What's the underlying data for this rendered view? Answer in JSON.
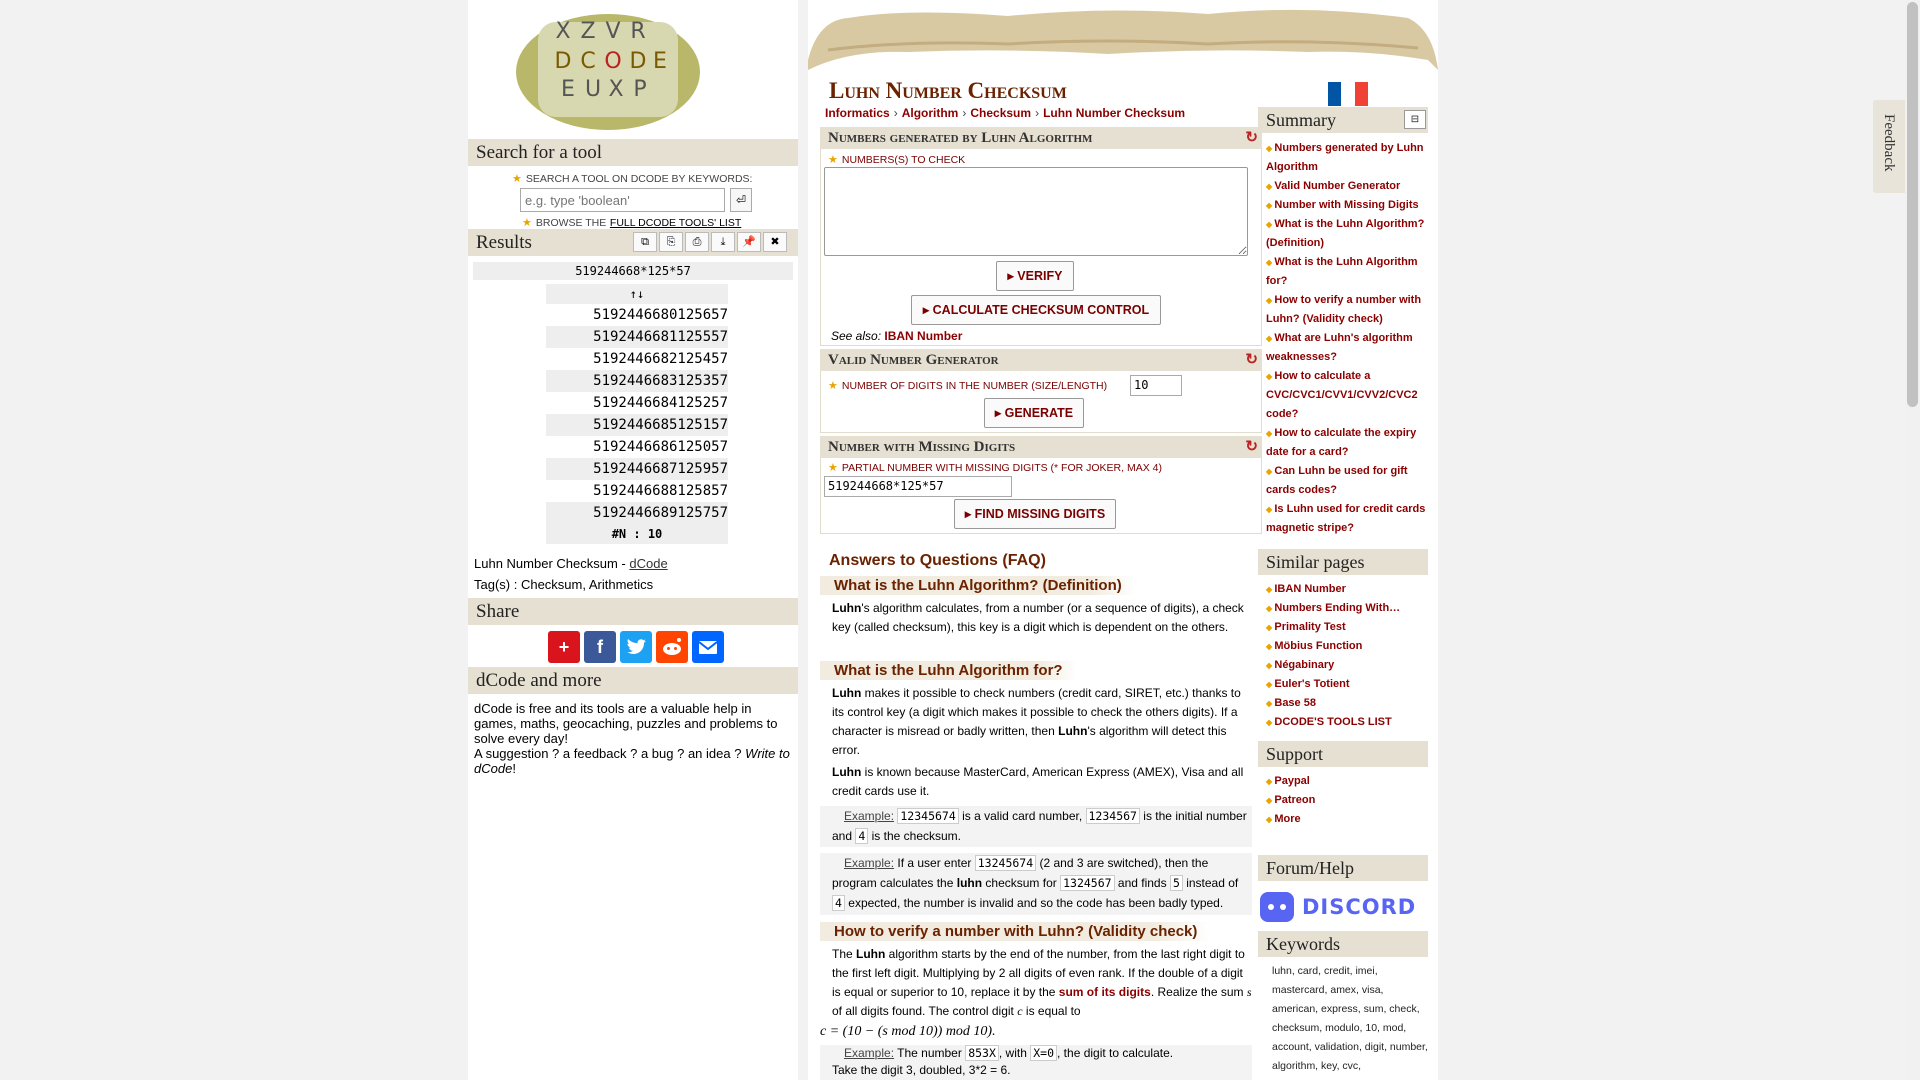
{
  "left": {
    "search_head": "Search for a tool",
    "search_label": "Search a tool on dCode by keywords:",
    "search_placeholder": "e.g. type 'boolean'",
    "browse_prefix": "Browse the",
    "browse_link": "full dCode tools' list",
    "results_head": "Results",
    "result_expr": "519244668*125*57",
    "result_sort": "↑↓",
    "results": [
      "5192446680125657",
      "5192446681125557",
      "5192446682125457",
      "5192446683125357",
      "5192446684125257",
      "5192446685125157",
      "5192446686125057",
      "5192446687125957",
      "5192446688125857",
      "5192446689125757"
    ],
    "result_count": "#N : 10",
    "source_text": "Luhn Number Checksum -",
    "source_link": "dCode",
    "tags": "Tag(s) : Checksum, Arithmetics",
    "share_head": "Share",
    "more_head": "dCode and more",
    "more_text": "dCode is free and its tools are a valuable help in games, maths, geocaching, puzzles and problems to solve every day!",
    "suggest_text": "A suggestion ? a feedback ? a bug ? an idea ?",
    "suggest_link": "Write to dCode",
    "suggest_end": "!"
  },
  "main": {
    "title": "Luhn Number Checksum",
    "breadcrumb": [
      "Informatics",
      "Algorithm",
      "Checksum",
      "Luhn Number Checksum"
    ],
    "breadcrumb_sep": "›",
    "tool1": {
      "head": "Numbers generated by Luhn Algorithm",
      "label": "Numbers(s) to check",
      "verify": "VERIFY",
      "calc": "CALCULATE CHECKSUM CONTROL",
      "see_also": "See also:",
      "see_also_link": "IBAN Number"
    },
    "tool2": {
      "head": "Valid Number Generator",
      "label": "Number of digits in the number (size/length)",
      "value": "10",
      "generate": "GENERATE"
    },
    "tool3": {
      "head": "Number with Missing Digits",
      "label": "Partial number with missing digits (* for joker, max 4)",
      "value": "519244668*125*57",
      "find": "FIND MISSING DIGITS"
    },
    "faq_title": "Answers to Questions (FAQ)",
    "q1": "What is the Luhn Algorithm? (Definition)",
    "p1_b": "Luhn",
    "p1": "'s algorithm calculates, from a number (or a sequence of digits), a check key (called checksum), this key is a digit which is dependent on the others.",
    "q2": "What is the Luhn Algorithm for?",
    "p2_b": "Luhn",
    "p2a": " makes it possible to check numbers (credit card, SIRET, etc.) thanks to its control key (a digit which makes it possible to check the others digits). If a character is misread or badly written, then ",
    "p2_b2": "Luhn",
    "p2b": "'s algorithm will detect this error.",
    "p3_b": "Luhn",
    "p3": " is known because MasterCard, American Express (AMEX), Visa and all credit cards use it.",
    "example_label": "Example:",
    "ex1_c1": "12345674",
    "ex1_t1": " is a valid card number, ",
    "ex1_c2": "1234567",
    "ex1_t2": " is the initial number and ",
    "ex1_c3": "4",
    "ex1_t3": " is the checksum.",
    "ex2_t0": " If a user enter ",
    "ex2_c1": "13245674",
    "ex2_t1": " (2 and 3 are switched), then the program calculates the ",
    "ex2_b": "luhn",
    "ex2_t2": " checksum for ",
    "ex2_c2": "1324567",
    "ex2_t3": " and finds ",
    "ex2_c3": "5",
    "ex2_t4": " instead of ",
    "ex2_c4": "4",
    "ex2_t5": " expected, the number is invalid and so the code has been badly typed.",
    "q3": "How to verify a number with Luhn? (Validity check)",
    "p4a": "The ",
    "p4_b": "Luhn",
    "p4b": " algorithm starts by the end of the number, from the last right digit to the first left digit. Multiplying by 2 all digits of even rank. If the double of a digit is equal or superior to 10, replace it by the ",
    "p4_link": "sum of its digits",
    "p4c": ". Realize the sum ",
    "p4_s": "s",
    "p4d": " of all digits found. The control digit ",
    "p4_c": "c",
    "p4e": " is equal to",
    "formula": "c = (10 − (s  mod 10))  mod 10).",
    "ex3_t0": " The number ",
    "ex3_c1": "853X",
    "ex3_t1": ", with ",
    "ex3_c2": "X=0",
    "ex3_t2": ", the digit to calculate.",
    "ex3_line2": "Take the digit 3, doubled, 3*2 = 6."
  },
  "side": {
    "summary_head": "Summary",
    "summary_toggle": "⊟",
    "summary": [
      "Numbers generated by Luhn Algorithm",
      "Valid Number Generator",
      "Number with Missing Digits",
      "What is the Luhn Algorithm? (Definition)",
      "What is the Luhn Algorithm for?",
      "How to verify a number with Luhn? (Validity check)",
      "What are Luhn's algorithm weaknesses?",
      "How to calculate a CVC/CVC1/CVV1/CVV2/CVC2 code?",
      "How to calculate the expiry date for a card?",
      "Can Luhn be used for gift cards codes?",
      "Is Luhn used for credit cards magnetic stripe?"
    ],
    "similar_head": "Similar pages",
    "similar": [
      "IBAN Number",
      "Numbers Ending With…",
      "Primality Test",
      "Möbius Function",
      "Négabinary",
      "Euler's Totient",
      "Base 58",
      "DCODE'S TOOLS LIST"
    ],
    "support_head": "Support",
    "support": [
      "Paypal",
      "Patreon",
      "More"
    ],
    "forum_head": "Forum/Help",
    "discord_text": "DISCORD",
    "keywords_head": "Keywords",
    "keywords": "luhn, card, credit, imei, mastercard, amex, visa, american, express, sum, check, checksum, modulo, 10, mod, account, validation, digit, number, algorithm, key, cvc,"
  },
  "feedback": "Feedback",
  "colors": {
    "accent": "#8b0000",
    "title": "#6a2200",
    "section": "#e6e0d2",
    "star": "#e9a400"
  }
}
